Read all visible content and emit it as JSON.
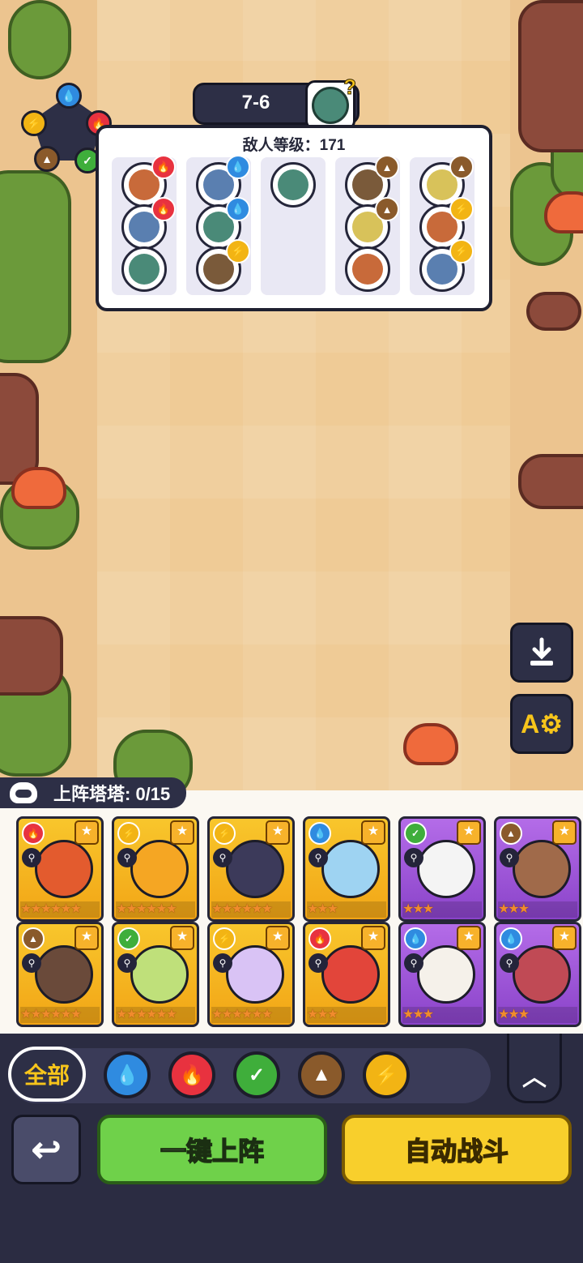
{
  "stage": {
    "label": "7-6"
  },
  "enemy_panel": {
    "title": "敌人等级：171",
    "columns": [
      [
        {
          "element": "fire"
        },
        {
          "element": "fire"
        },
        {
          "element": "none"
        }
      ],
      [
        {
          "element": "water"
        },
        {
          "element": "water"
        },
        {
          "element": "thunder"
        }
      ],
      [
        {
          "element": "none"
        }
      ],
      [
        {
          "element": "earth"
        },
        {
          "element": "earth"
        },
        {
          "element": "none"
        }
      ],
      [
        {
          "element": "earth"
        },
        {
          "element": "thunder"
        },
        {
          "element": "thunder"
        }
      ]
    ]
  },
  "roster": {
    "label": "上阵塔塔: 0/15"
  },
  "cards": [
    {
      "element": "fire",
      "bg": "gold",
      "stars": "★★★★★★"
    },
    {
      "element": "thunder",
      "bg": "gold",
      "stars": "★★★★★★"
    },
    {
      "element": "thunder",
      "bg": "gold",
      "stars": "★★★★★★"
    },
    {
      "element": "water",
      "bg": "gold",
      "stars": "★★★"
    },
    {
      "element": "grass",
      "bg": "purple",
      "stars": "★★★"
    },
    {
      "element": "earth",
      "bg": "purple",
      "stars": "★★★"
    },
    {
      "element": "earth",
      "bg": "gold",
      "stars": "★★★★★★"
    },
    {
      "element": "grass",
      "bg": "gold",
      "stars": "★★★★★★"
    },
    {
      "element": "thunder",
      "bg": "gold",
      "stars": "★★★★★★"
    },
    {
      "element": "fire",
      "bg": "gold",
      "stars": "★★★"
    },
    {
      "element": "water",
      "bg": "purple",
      "stars": "★★★"
    },
    {
      "element": "water",
      "bg": "purple",
      "stars": "★★★"
    }
  ],
  "filters": {
    "all_label": "全部"
  },
  "buttons": {
    "deploy_label": "一键上阵",
    "auto_label": "自动战斗"
  },
  "colors": {
    "water": "#2f8be0",
    "fire": "#e8323f",
    "grass": "#3fae3b",
    "earth": "#8a5a2b",
    "thunder": "#f2b414",
    "none": "#ffffff"
  }
}
